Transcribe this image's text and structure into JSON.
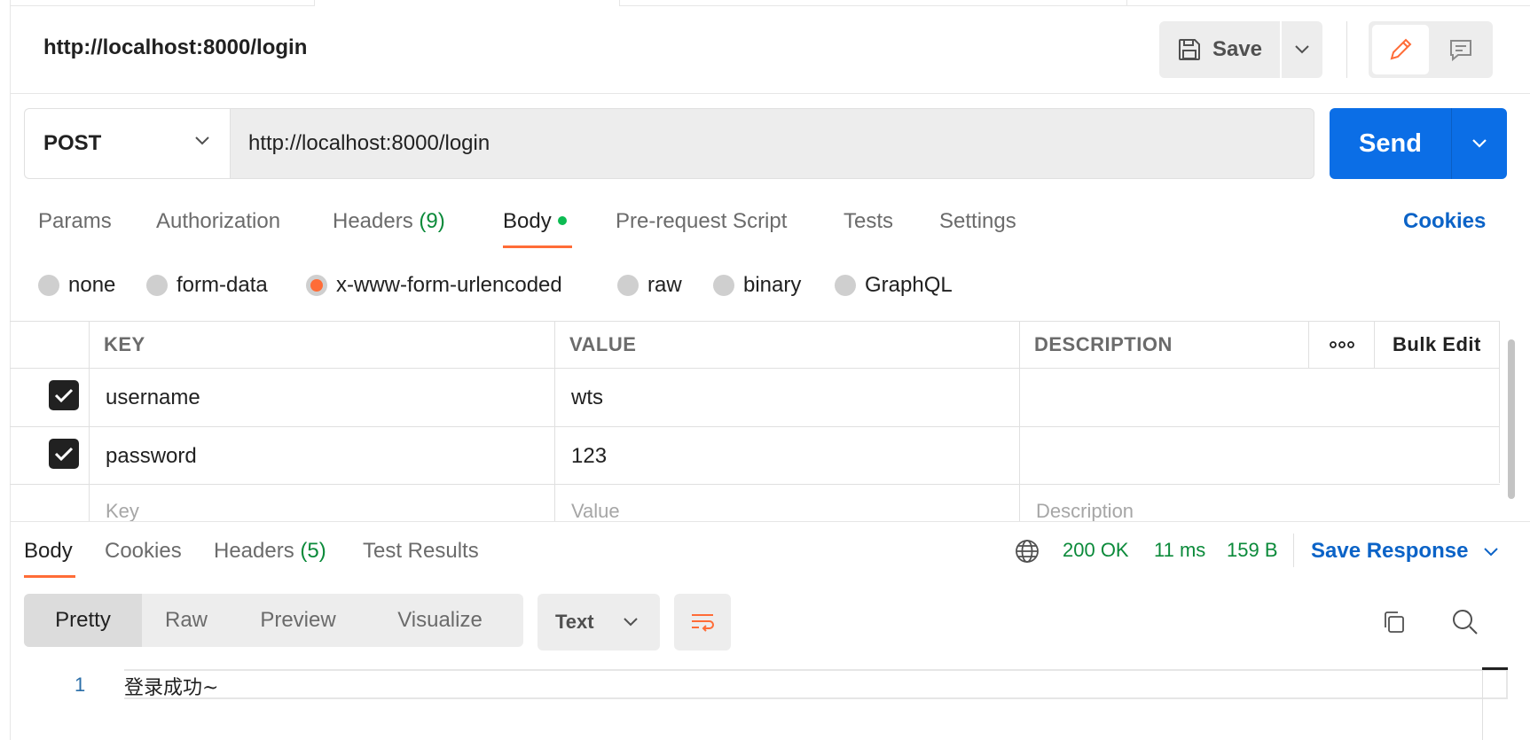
{
  "request": {
    "title": "http://localhost:8000/login",
    "save_label": "Save",
    "method": "POST",
    "url": "http://localhost:8000/login",
    "send_label": "Send"
  },
  "request_tabs": {
    "params": "Params",
    "authorization": "Authorization",
    "headers_label": "Headers",
    "headers_count": "(9)",
    "body": "Body",
    "pre_request": "Pre-request Script",
    "tests": "Tests",
    "settings": "Settings",
    "cookies": "Cookies",
    "active": "Body"
  },
  "body_types": {
    "none": "none",
    "form_data": "form-data",
    "urlencoded": "x-www-form-urlencoded",
    "raw": "raw",
    "binary": "binary",
    "graphql": "GraphQL",
    "selected": "x-www-form-urlencoded"
  },
  "params_table": {
    "headers": {
      "key": "KEY",
      "value": "VALUE",
      "description": "DESCRIPTION",
      "more": "ooo",
      "bulk_edit": "Bulk Edit"
    },
    "rows": [
      {
        "checked": true,
        "key": "username",
        "value": "wts",
        "description": ""
      },
      {
        "checked": true,
        "key": "password",
        "value": "123",
        "description": ""
      }
    ],
    "placeholders": {
      "key": "Key",
      "value": "Value",
      "description": "Description"
    }
  },
  "response": {
    "tabs": {
      "body": "Body",
      "cookies": "Cookies",
      "headers_label": "Headers",
      "headers_count": "(5)",
      "test_results": "Test Results",
      "active": "Body"
    },
    "status": "200 OK",
    "time": "11 ms",
    "size": "159 B",
    "save_response": "Save Response",
    "formats": {
      "pretty": "Pretty",
      "raw": "Raw",
      "preview": "Preview",
      "visualize": "Visualize",
      "active": "Pretty"
    },
    "language": "Text",
    "lines": [
      {
        "number": "1",
        "text": "登录成功~"
      }
    ]
  },
  "colors": {
    "accent": "#ff6c37",
    "send_blue": "#0b6ee6",
    "link_blue": "#0b63c7",
    "status_green": "#0b8a3a",
    "body_dot_green": "#0cbb52"
  },
  "icons": {
    "save": "floppy-disk-icon",
    "edit": "pencil-icon",
    "comments": "comment-icon",
    "globe": "globe-icon",
    "wrap": "word-wrap-icon",
    "copy": "copy-icon",
    "search": "search-icon"
  }
}
